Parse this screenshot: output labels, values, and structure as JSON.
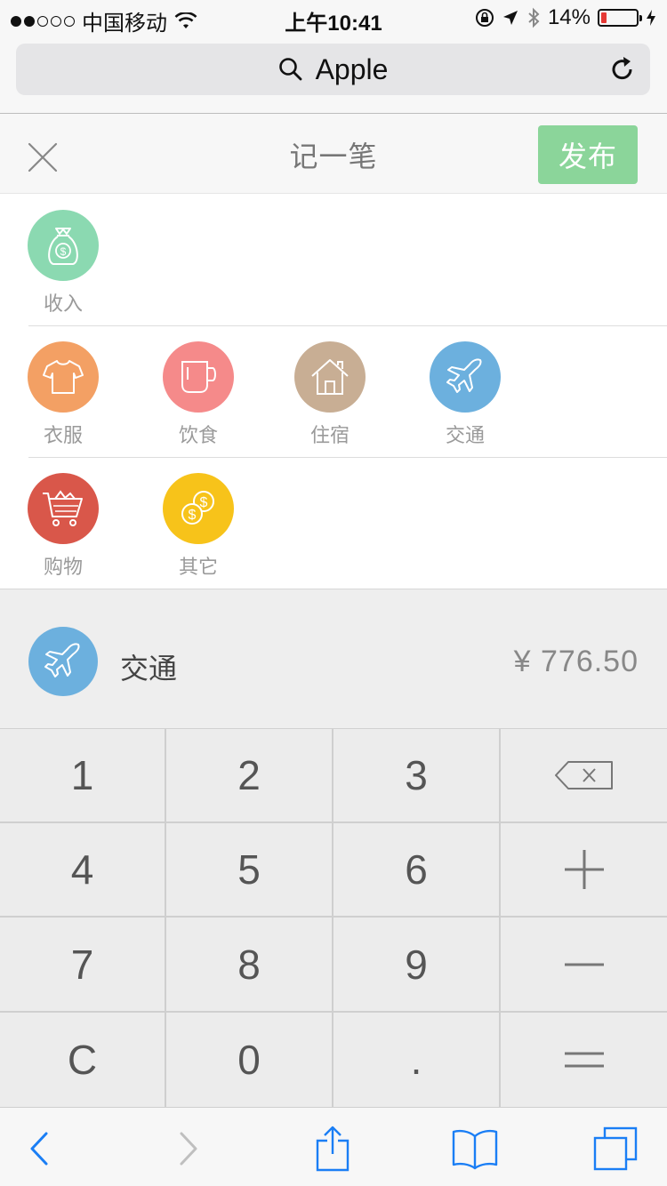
{
  "status_bar": {
    "carrier": "中国移动",
    "time": "上午10:41",
    "battery_percent": "14%",
    "battery_level": 0.14,
    "icons": [
      "signal-dots-icon",
      "wifi-icon",
      "orientation-lock-icon",
      "location-arrow-icon",
      "bluetooth-icon",
      "battery-icon",
      "charging-bolt-icon"
    ]
  },
  "browser": {
    "address_text": "Apple",
    "icons": [
      "search-icon",
      "reload-icon"
    ]
  },
  "header": {
    "title": "记一笔",
    "publish_label": "发布",
    "close_icon": "close-icon"
  },
  "categories": {
    "rows": [
      [
        {
          "label": "收入",
          "icon": "money-bag-icon",
          "color": "#8bd9b1"
        }
      ],
      [
        {
          "label": "衣服",
          "icon": "tshirt-icon",
          "color": "#f3a064"
        },
        {
          "label": "饮食",
          "icon": "mug-icon",
          "color": "#f58a8a"
        },
        {
          "label": "住宿",
          "icon": "house-icon",
          "color": "#c8ae94"
        },
        {
          "label": "交通",
          "icon": "airplane-icon",
          "color": "#6cb0de"
        }
      ],
      [
        {
          "label": "购物",
          "icon": "shopping-cart-icon",
          "color": "#d9574a"
        },
        {
          "label": "其它",
          "icon": "coins-icon",
          "color": "#f7c31a"
        }
      ]
    ]
  },
  "summary": {
    "category": "交通",
    "amount": "¥ 776.50",
    "icon": "airplane-icon",
    "color": "#6cb0de"
  },
  "keypad": {
    "keys": [
      "1",
      "2",
      "3",
      "⌫",
      "4",
      "5",
      "6",
      "+",
      "7",
      "8",
      "9",
      "−",
      "C",
      "0",
      ".",
      "="
    ]
  },
  "toolbar": {
    "icons": [
      "back-icon",
      "forward-icon",
      "share-icon",
      "bookmarks-icon",
      "tabs-icon"
    ],
    "accent": "#1a7ef5"
  }
}
